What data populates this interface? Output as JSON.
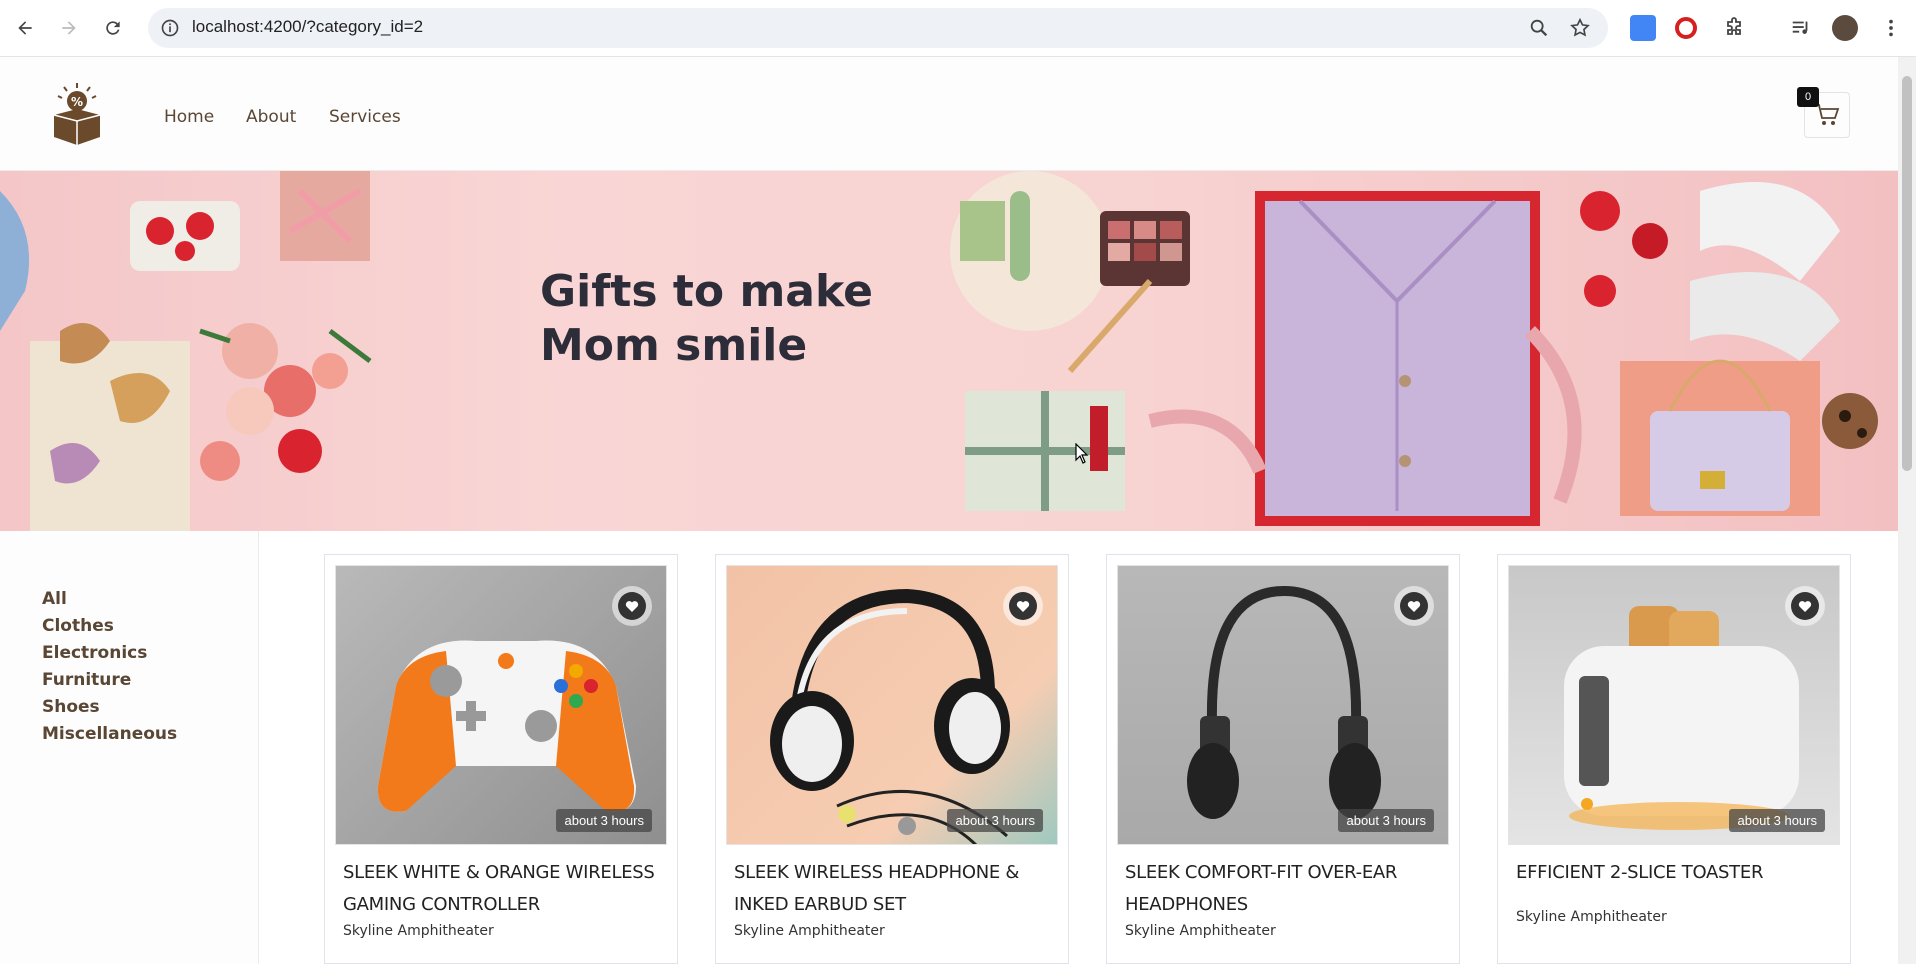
{
  "browser": {
    "url": "localhost:4200/?category_id=2"
  },
  "header": {
    "menu": [
      "Home",
      "About",
      "Services"
    ],
    "cart_count": "0"
  },
  "banner": {
    "title": "Gifts to make\nMom smile"
  },
  "sidebar": {
    "categories": [
      "All",
      "Clothes",
      "Electronics",
      "Furniture",
      "Shoes",
      "Miscellaneous"
    ]
  },
  "products": [
    {
      "title": "Sleek White & Orange Wireless Gaming Controller",
      "location": "Skyline Amphitheater",
      "time": "about 3 hours"
    },
    {
      "title": "Sleek Wireless Headphone & Inked Earbud Set",
      "location": "Skyline Amphitheater",
      "time": "about 3 hours"
    },
    {
      "title": "Sleek Comfort-Fit Over-Ear Headphones",
      "location": "Skyline Amphitheater",
      "time": "about 3 hours"
    },
    {
      "title": "Efficient 2-Slice Toaster",
      "location": "Skyline Amphitheater",
      "time": "about 3 hours"
    }
  ],
  "colors": {
    "brand_text": "#5a4634",
    "banner_bg": "#f7d3d1"
  }
}
